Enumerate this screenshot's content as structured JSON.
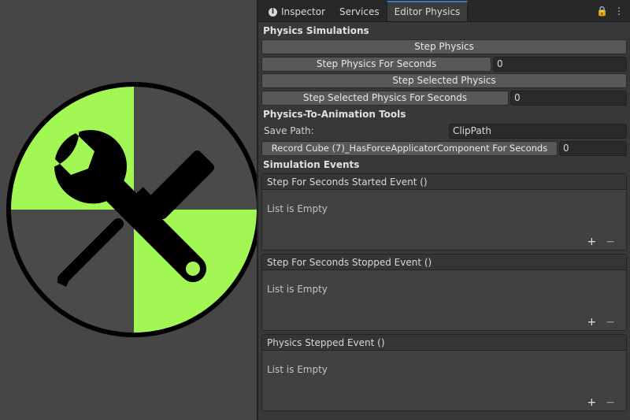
{
  "colors": {
    "accent": "#a2f755",
    "icon": "#000000",
    "panel": "#383838",
    "background": "#464646"
  },
  "logo": {
    "icon_names": [
      "wrench-icon",
      "screwdriver-icon"
    ]
  },
  "tabs": [
    {
      "label": "Inspector",
      "icon": "info-icon"
    },
    {
      "label": "Services"
    },
    {
      "label": "Editor Physics",
      "active": true
    }
  ],
  "tab_tools": {
    "lock": "🔒",
    "menu": "⋮"
  },
  "simulations": {
    "title": "Physics Simulations",
    "step_physics": "Step Physics",
    "step_for_seconds": "Step Physics For Seconds",
    "step_for_seconds_value": "0",
    "step_selected": "Step Selected Physics",
    "step_selected_for_seconds": "Step Selected Physics For Seconds",
    "step_selected_for_seconds_value": "0"
  },
  "animation_tools": {
    "title": "Physics-To-Animation Tools",
    "save_path_label": "Save Path:",
    "save_path_value": "ClipPath",
    "record_button": "Record Cube (7)_HasForceApplicatorComponent For Seconds",
    "record_value": "0"
  },
  "events": {
    "title": "Simulation Events",
    "items": [
      {
        "header": "Step For Seconds Started Event ()",
        "body": "List is Empty",
        "add": "+",
        "remove": "−"
      },
      {
        "header": "Step For Seconds Stopped Event ()",
        "body": "List is Empty",
        "add": "+",
        "remove": "−"
      },
      {
        "header": "Physics Stepped Event ()",
        "body": "List is Empty",
        "add": "+",
        "remove": "−"
      }
    ]
  }
}
